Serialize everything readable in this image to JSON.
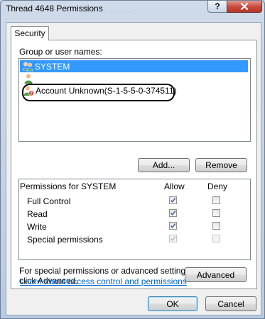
{
  "window": {
    "title": "Thread 4648 Permissions",
    "background_ghost_text": "···  ···· ·····  ·· ·· ·· ······"
  },
  "tabs": [
    {
      "label": "Security",
      "active": true
    }
  ],
  "group_section": {
    "label": "Group or user names:",
    "entries": [
      {
        "name": "SYSTEM",
        "icon": "users-group-icon",
        "selected": true
      },
      {
        "name": "",
        "icon": "user-icon",
        "selected": false,
        "obscured": true
      },
      {
        "name": "Account Unknown(S-1-5-5-0-374511)",
        "icon": "unknown-user-icon",
        "selected": false,
        "highlighted": true
      }
    ]
  },
  "buttons": {
    "add": "Add...",
    "remove": "Remove",
    "advanced": "Advanced",
    "ok": "OK",
    "cancel": "Cancel"
  },
  "permissions": {
    "header": "Permissions for SYSTEM",
    "allow_label": "Allow",
    "deny_label": "Deny",
    "rows": [
      {
        "name": "Full Control",
        "allow": true,
        "deny": false,
        "disabled": false
      },
      {
        "name": "Read",
        "allow": true,
        "deny": false,
        "disabled": false
      },
      {
        "name": "Write",
        "allow": true,
        "deny": false,
        "disabled": false
      },
      {
        "name": "Special permissions",
        "allow": true,
        "deny": false,
        "disabled": true
      }
    ]
  },
  "advanced_note": {
    "line1": "For special permissions or advanced settings,",
    "line2": "click Advanced."
  },
  "help_link": "Learn about access control and permissions",
  "colors": {
    "selection": "#3399ff",
    "link": "#0066cc",
    "close_button": "#c9483b"
  }
}
